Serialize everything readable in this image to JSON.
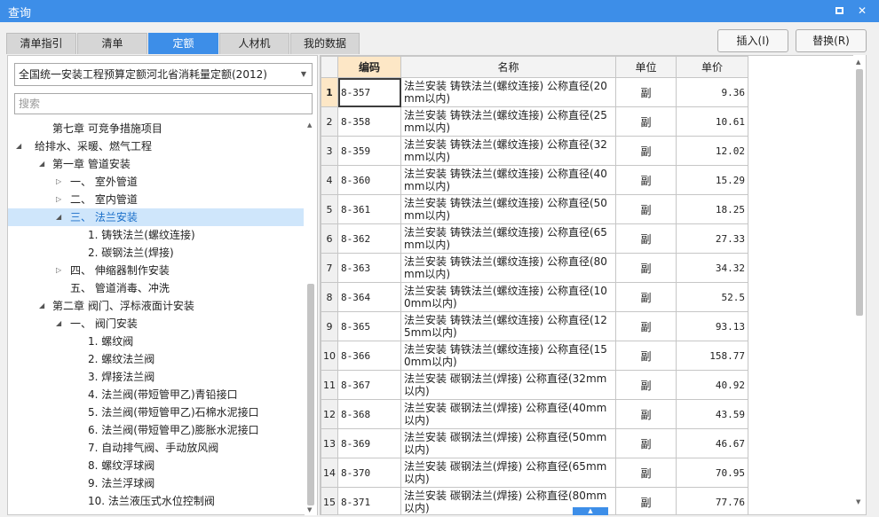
{
  "window": {
    "title": "查询"
  },
  "tabs": [
    "清单指引",
    "清单",
    "定额",
    "人材机",
    "我的数据"
  ],
  "buttons": {
    "insert": "插入(I)",
    "replace": "替换(R)"
  },
  "left": {
    "quota_select": "全国统一安装工程预算定额河北省消耗量定额(2012)",
    "search_placeholder": "搜索",
    "tree": [
      {
        "label": "第七章 可竞争措施项目"
      },
      {
        "label": "给排水、采暖、燃气工程"
      },
      {
        "label": "第一章 管道安装"
      },
      {
        "label": "一、 室外管道"
      },
      {
        "label": "二、 室内管道"
      },
      {
        "label": "三、 法兰安装"
      },
      {
        "label": "1. 铸铁法兰(螺纹连接)"
      },
      {
        "label": "2. 碳钢法兰(焊接)"
      },
      {
        "label": "四、 伸缩器制作安装"
      },
      {
        "label": "五、 管道消毒、冲洗"
      },
      {
        "label": "第二章 阀门、浮标液面计安装"
      },
      {
        "label": "一、 阀门安装"
      },
      {
        "label": "1. 螺纹阀"
      },
      {
        "label": "2. 螺纹法兰阀"
      },
      {
        "label": "3. 焊接法兰阀"
      },
      {
        "label": "4. 法兰阀(带短管甲乙)青铅接口"
      },
      {
        "label": "5. 法兰阀(带短管甲乙)石棉水泥接口"
      },
      {
        "label": "6. 法兰阀(带短管甲乙)膨胀水泥接口"
      },
      {
        "label": "7. 自动排气阀、手动放风阀"
      },
      {
        "label": "8. 螺纹浮球阀"
      },
      {
        "label": "9. 法兰浮球阀"
      },
      {
        "label": "10. 法兰液压式水位控制阀"
      }
    ]
  },
  "grid": {
    "headers": {
      "code": "编码",
      "name": "名称",
      "unit": "单位",
      "price": "单价"
    },
    "rows": [
      {
        "no": "1",
        "code": "8-357",
        "name": "法兰安装 铸铁法兰(螺纹连接) 公称直径(20mm以内)",
        "unit": "副",
        "price": "9.36"
      },
      {
        "no": "2",
        "code": "8-358",
        "name": "法兰安装 铸铁法兰(螺纹连接) 公称直径(25mm以内)",
        "unit": "副",
        "price": "10.61"
      },
      {
        "no": "3",
        "code": "8-359",
        "name": "法兰安装 铸铁法兰(螺纹连接) 公称直径(32mm以内)",
        "unit": "副",
        "price": "12.02"
      },
      {
        "no": "4",
        "code": "8-360",
        "name": "法兰安装 铸铁法兰(螺纹连接) 公称直径(40mm以内)",
        "unit": "副",
        "price": "15.29"
      },
      {
        "no": "5",
        "code": "8-361",
        "name": "法兰安装 铸铁法兰(螺纹连接) 公称直径(50mm以内)",
        "unit": "副",
        "price": "18.25"
      },
      {
        "no": "6",
        "code": "8-362",
        "name": "法兰安装 铸铁法兰(螺纹连接) 公称直径(65mm以内)",
        "unit": "副",
        "price": "27.33"
      },
      {
        "no": "7",
        "code": "8-363",
        "name": "法兰安装 铸铁法兰(螺纹连接) 公称直径(80mm以内)",
        "unit": "副",
        "price": "34.32"
      },
      {
        "no": "8",
        "code": "8-364",
        "name": "法兰安装 铸铁法兰(螺纹连接) 公称直径(100mm以内)",
        "unit": "副",
        "price": "52.5"
      },
      {
        "no": "9",
        "code": "8-365",
        "name": "法兰安装 铸铁法兰(螺纹连接) 公称直径(125mm以内)",
        "unit": "副",
        "price": "93.13"
      },
      {
        "no": "10",
        "code": "8-366",
        "name": "法兰安装 铸铁法兰(螺纹连接) 公称直径(150mm以内)",
        "unit": "副",
        "price": "158.77"
      },
      {
        "no": "11",
        "code": "8-367",
        "name": "法兰安装 碳钢法兰(焊接) 公称直径(32mm以内)",
        "unit": "副",
        "price": "40.92"
      },
      {
        "no": "12",
        "code": "8-368",
        "name": "法兰安装 碳钢法兰(焊接) 公称直径(40mm以内)",
        "unit": "副",
        "price": "43.59"
      },
      {
        "no": "13",
        "code": "8-369",
        "name": "法兰安装 碳钢法兰(焊接) 公称直径(50mm以内)",
        "unit": "副",
        "price": "46.67"
      },
      {
        "no": "14",
        "code": "8-370",
        "name": "法兰安装 碳钢法兰(焊接) 公称直径(65mm以内)",
        "unit": "副",
        "price": "70.95"
      },
      {
        "no": "15",
        "code": "8-371",
        "name": "法兰安装 碳钢法兰(焊接) 公称直径(80mm以内)",
        "unit": "副",
        "price": "77.76"
      }
    ]
  },
  "colors": {
    "accent": "#3d8ee8",
    "header_highlight": "#fde7c6",
    "tree_selected": "#cfe6fb"
  }
}
